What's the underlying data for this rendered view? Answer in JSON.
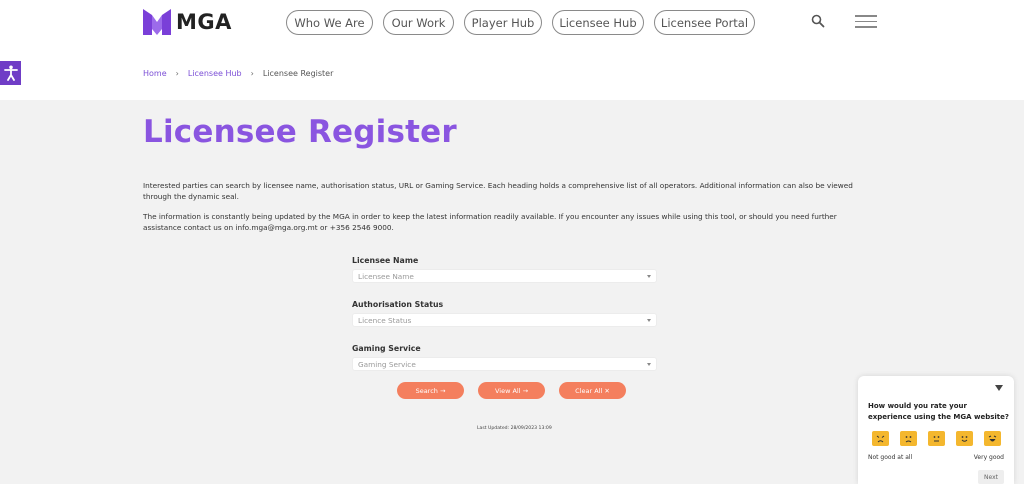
{
  "header": {
    "logo_text": "MGA",
    "nav": [
      {
        "label": "Who We Are"
      },
      {
        "label": "Our Work"
      },
      {
        "label": "Player Hub"
      },
      {
        "label": "Licensee Hub"
      },
      {
        "label": "Licensee Portal"
      }
    ]
  },
  "breadcrumb": {
    "items": [
      "Home",
      "Licensee Hub",
      "Licensee Register"
    ]
  },
  "main": {
    "title": "Licensee Register",
    "intro1": "Interested parties can search by licensee name, authorisation status, URL or Gaming Service. Each heading holds a comprehensive list of all operators. Additional information can also be viewed through the dynamic seal.",
    "intro2": "The information is constantly being updated by the MGA in order to keep the latest information readily available. If you encounter any issues while using this tool, or should you need further assistance contact us on info.mga@mga.org.mt or +356 2546 9000."
  },
  "form": {
    "fields": [
      {
        "label": "Licensee Name",
        "placeholder": "Licensee Name"
      },
      {
        "label": "Authorisation Status",
        "placeholder": "Licence Status"
      },
      {
        "label": "Gaming Service",
        "placeholder": "Gaming Service"
      }
    ],
    "buttons": {
      "search": "Search →",
      "view_all": "View All →",
      "clear_all": "Clear All ✕"
    },
    "last_updated": "Last Updated: 28/09/2023 13:09"
  },
  "feedback": {
    "question": "How would you rate your experience using the MGA website?",
    "low_label": "Not good at all",
    "high_label": "Very good",
    "next_label": "Next"
  },
  "colors": {
    "accent": "#8a55e0",
    "button": "#f47f5e",
    "face": "#f4b72e"
  }
}
